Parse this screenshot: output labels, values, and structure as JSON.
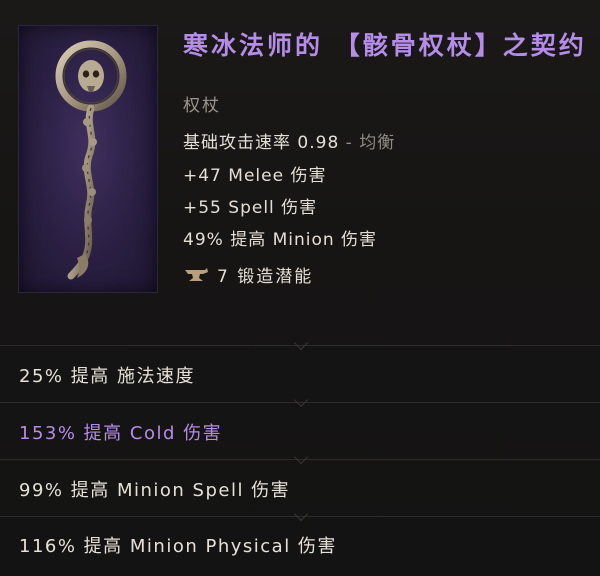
{
  "item": {
    "title": "寒冰法师的 【骸骨权杖】之契约",
    "type": "权杖",
    "base_stat": {
      "label": "基础攻击速率 0.98",
      "suffix": "- 均衡"
    },
    "implicits": [
      "+47 Melee 伤害",
      "+55 Spell 伤害",
      "49% 提高 Minion 伤害"
    ],
    "forge": "7 锻造潜能",
    "icon": "bone-scepter-icon"
  },
  "affixes": [
    {
      "text": "25% 提高 施法速度",
      "rarity": "normal"
    },
    {
      "text": "153% 提高 Cold 伤害",
      "rarity": "rare"
    },
    {
      "text": "99% 提高 Minion Spell 伤害",
      "rarity": "normal"
    },
    {
      "text": "116% 提高 Minion Physical 伤害",
      "rarity": "normal"
    }
  ],
  "colors": {
    "title": "#b58ce8",
    "rare_affix": "#b58ce8",
    "text": "#e6e1d8",
    "dim": "#8f8a83",
    "icon_bg": "#2a1f42"
  }
}
